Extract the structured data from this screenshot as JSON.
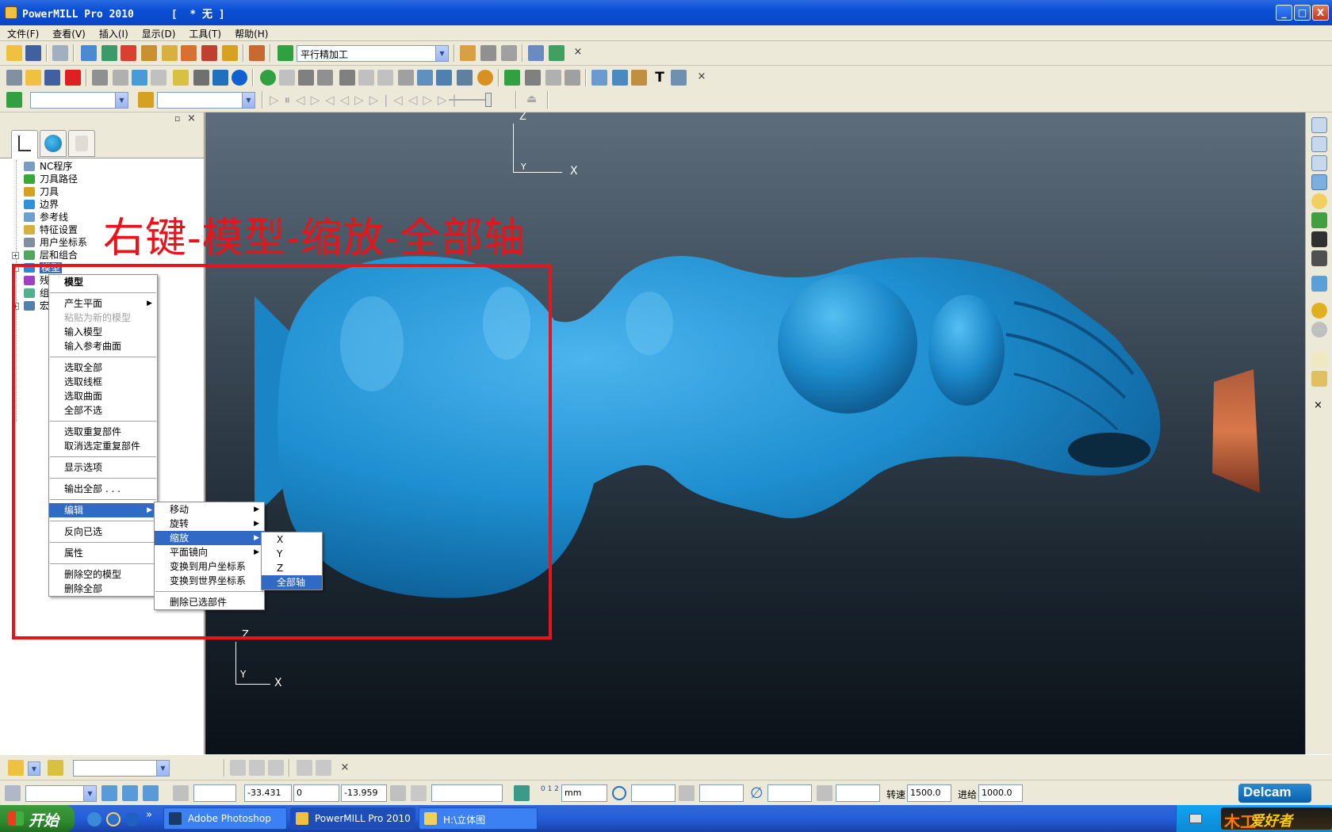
{
  "window": {
    "title": "PowerMILL Pro 2010      [  * 无 ]",
    "buttons": {
      "minimize": "_",
      "maximize": "□",
      "close": "X"
    }
  },
  "menubar": [
    "文件(F)",
    "查看(V)",
    "插入(I)",
    "显示(D)",
    "工具(T)",
    "帮助(H)"
  ],
  "toolbar1": {
    "strategy_combo": "平行精加工",
    "close": "×"
  },
  "toolbar2": {
    "close": "×"
  },
  "toolbar3": {
    "combo1": "",
    "combo2": "",
    "close": ""
  },
  "explorer": {
    "pin": "▫",
    "close": "×",
    "tree": [
      {
        "label": "NC程序",
        "color": "#7a9cc0"
      },
      {
        "label": "刀具路径",
        "color": "#38a838"
      },
      {
        "label": "刀具",
        "color": "#d8a020"
      },
      {
        "label": "边界",
        "color": "#3090d8"
      },
      {
        "label": "参考线",
        "color": "#6aa0d0"
      },
      {
        "label": "特征设置",
        "color": "#d8b040"
      },
      {
        "label": "用户坐标系",
        "color": "#8090a0"
      },
      {
        "label": "层和组合",
        "color": "#50a860",
        "expander": "+"
      },
      {
        "label": "模型",
        "color": "#2a8ad8",
        "expander": "-",
        "selected": true
      },
      {
        "label": "残",
        "color": "#a040c0"
      },
      {
        "label": "组",
        "color": "#50b090"
      },
      {
        "label": "宏",
        "color": "#5080b0",
        "expander": "+"
      }
    ]
  },
  "annotation": {
    "text": "右键-模型-缩放-全部轴",
    "color": "#e8141a"
  },
  "axis_top": {
    "z": "Z",
    "y": "Y",
    "x": "X"
  },
  "axis_bottom": {
    "z": "Z",
    "y": "Y",
    "x": "X"
  },
  "context_menu": {
    "main": [
      {
        "label": "模型",
        "bold": true
      },
      {
        "sep": true
      },
      {
        "label": "产生平面",
        "sub": true
      },
      {
        "label": "粘贴为新的模型",
        "disabled": true
      },
      {
        "label": "输入模型"
      },
      {
        "label": "输入参考曲面"
      },
      {
        "sep": true
      },
      {
        "label": "选取全部"
      },
      {
        "label": "选取线框"
      },
      {
        "label": "选取曲面"
      },
      {
        "label": "全部不选"
      },
      {
        "sep": true
      },
      {
        "label": "选取重复部件"
      },
      {
        "label": "取消选定重复部件"
      },
      {
        "sep": true
      },
      {
        "label": "显示选项"
      },
      {
        "sep": true
      },
      {
        "label": "输出全部 . . ."
      },
      {
        "sep": true
      },
      {
        "label": "编辑",
        "sub": true,
        "active": true
      },
      {
        "sep": true
      },
      {
        "label": "反向已选"
      },
      {
        "sep": true
      },
      {
        "label": "属性"
      },
      {
        "sep": true
      },
      {
        "label": "删除空的模型"
      },
      {
        "label": "删除全部"
      }
    ],
    "edit": [
      {
        "label": "移动",
        "sub": true
      },
      {
        "label": "旋转",
        "sub": true
      },
      {
        "label": "缩放",
        "sub": true,
        "active": true
      },
      {
        "label": "平面镜向",
        "sub": true
      },
      {
        "label": "变换到用户坐标系"
      },
      {
        "label": "变换到世界坐标系"
      },
      {
        "sep": true
      },
      {
        "label": "删除已选部件"
      }
    ],
    "scale": [
      {
        "label": "X"
      },
      {
        "label": "Y"
      },
      {
        "label": "Z"
      },
      {
        "label": "全部轴",
        "active": true
      }
    ]
  },
  "statusbar": {
    "coord_x": "-33.431",
    "coord_y": "0",
    "coord_z": "-13.959",
    "units": "mm",
    "ruler": "0 1 2",
    "speed_label": "转速",
    "speed_value": "1500.0",
    "feed_label": "进给",
    "feed_value": "1000.0",
    "close": "×",
    "logo": "Delcam"
  },
  "taskbar": {
    "start": "开始",
    "quick_more": "»",
    "tasks": [
      {
        "label": "Adobe Photoshop",
        "color": "#1a3a6a"
      },
      {
        "label": "PowerMILL Pro 2010 ...",
        "color": "#f0c040",
        "active": true
      },
      {
        "label": "H:\\立体图",
        "color": "#f0d060"
      }
    ],
    "tray_logo": "爱好者",
    "tray_mark": "木工"
  },
  "colors": {
    "model_blue": "#1e8fd0",
    "annotation_red": "#e8141a",
    "selection_blue": "#316ac5"
  }
}
